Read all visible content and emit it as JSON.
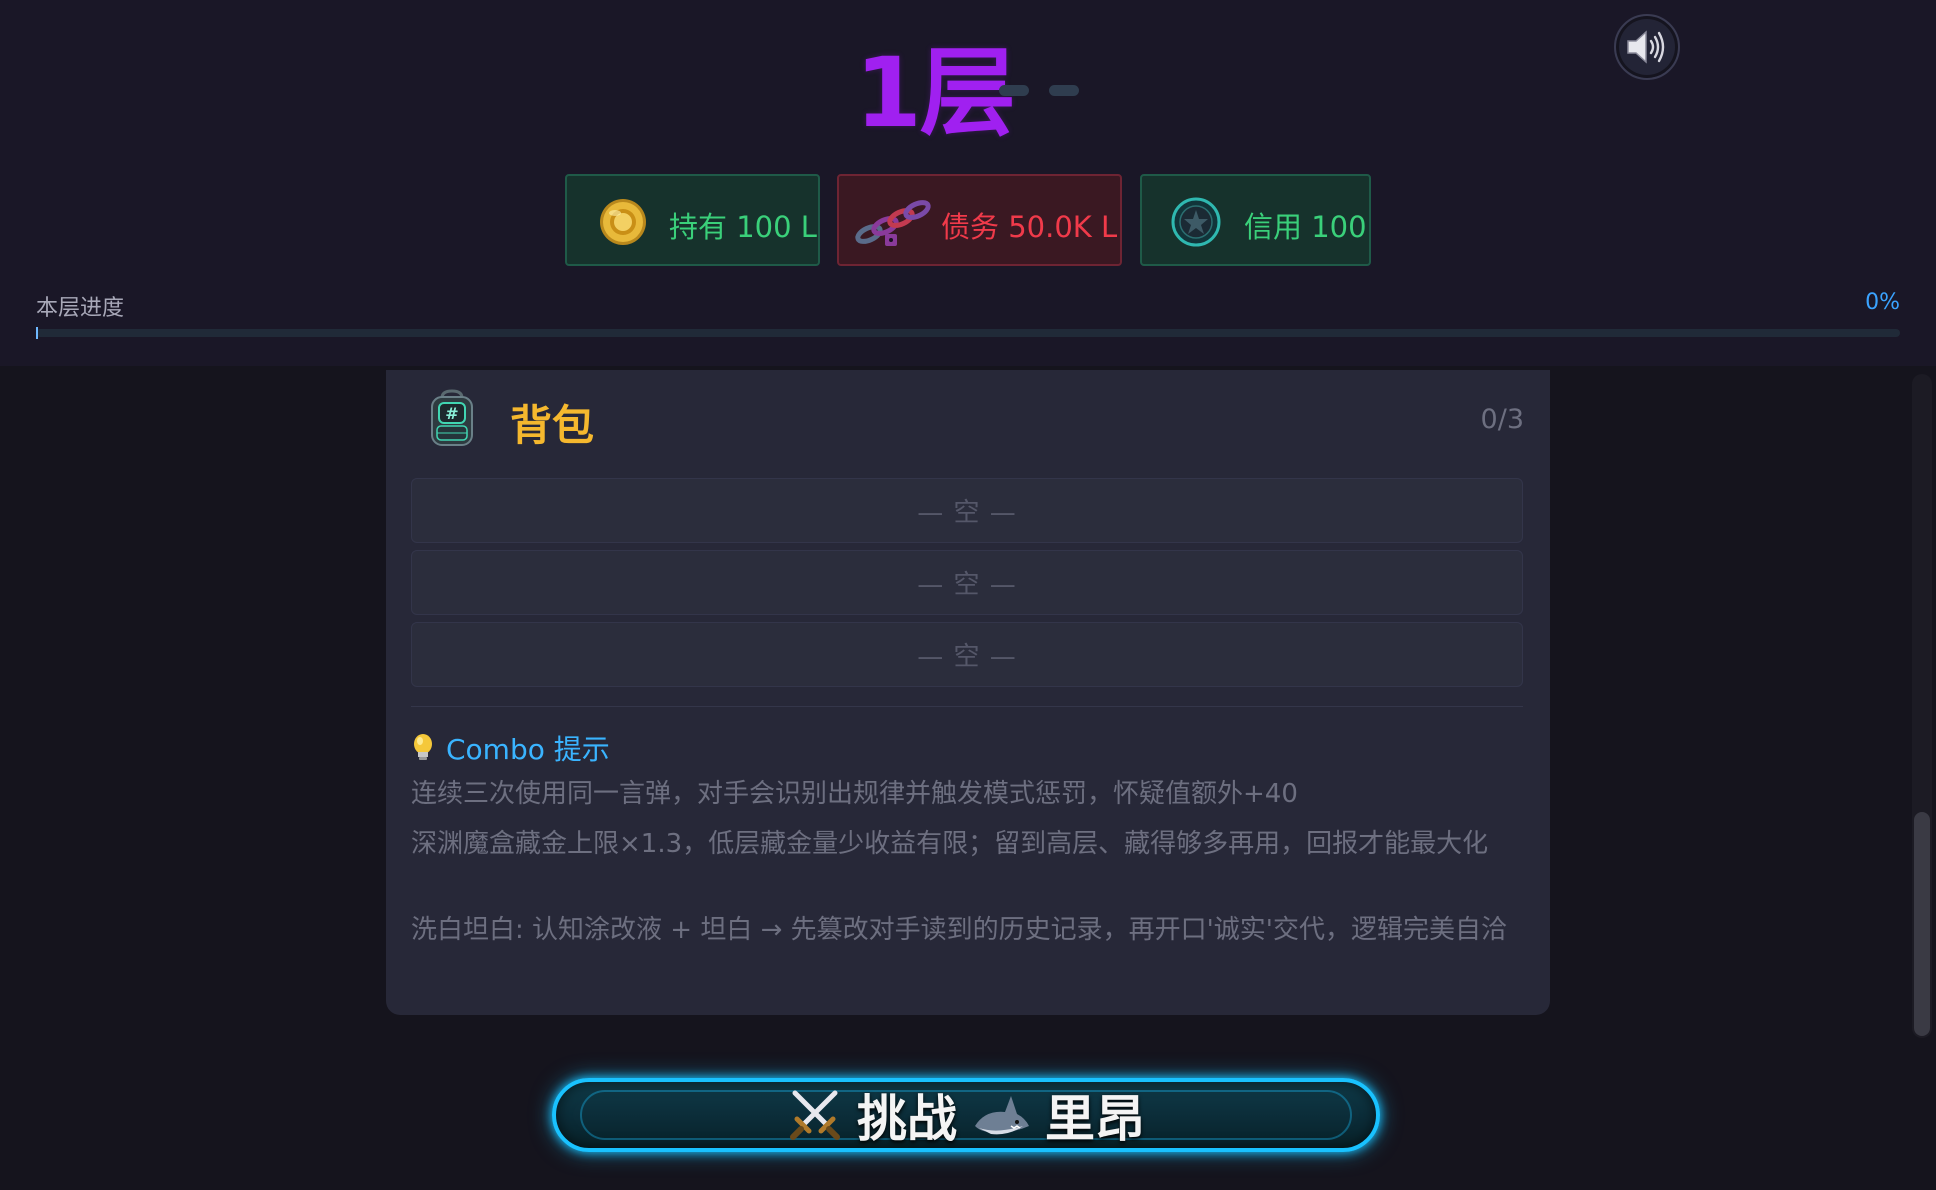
{
  "header": {
    "floor_title": "1层",
    "sound_icon": "speaker-icon"
  },
  "stats": {
    "hold": {
      "label": "持有 100 L",
      "icon": "gold-coin-icon"
    },
    "debt": {
      "label": "债务 50.0K L",
      "icon": "chain-icon"
    },
    "credit": {
      "label": "信用 100",
      "icon": "badge-icon"
    }
  },
  "progress": {
    "label": "本层进度",
    "value_text": "0%",
    "value": 0
  },
  "backpack": {
    "title": "背包",
    "count": "0/3",
    "icon": "backpack-icon",
    "slots": [
      "— 空 —",
      "— 空 —",
      "— 空 —"
    ]
  },
  "combo": {
    "title": "Combo 提示",
    "icon": "lightbulb-icon",
    "tips": [
      "连续三次使用同一言弹，对手会识别出规律并触发模式惩罚，怀疑值额外+40",
      "深渊魔盒藏金上限×1.3，低层藏金量少收益有限；留到高层、藏得够多再用，回报才能最大化",
      "洗白坦白: 认知涂改液 + 坦白 → 先篡改对手读到的历史记录，再开口'诚实'交代，逻辑完美自洽"
    ]
  },
  "challenge": {
    "verb": "挑战",
    "opponent": "里昂",
    "icons": [
      "crossed-swords-icon",
      "shark-icon"
    ]
  },
  "colors": {
    "floor_title": "#a020f0",
    "hold": "#3ad07a",
    "debt": "#f03a4a",
    "gold": "#f5b82e",
    "accent": "#3ab4ff"
  }
}
